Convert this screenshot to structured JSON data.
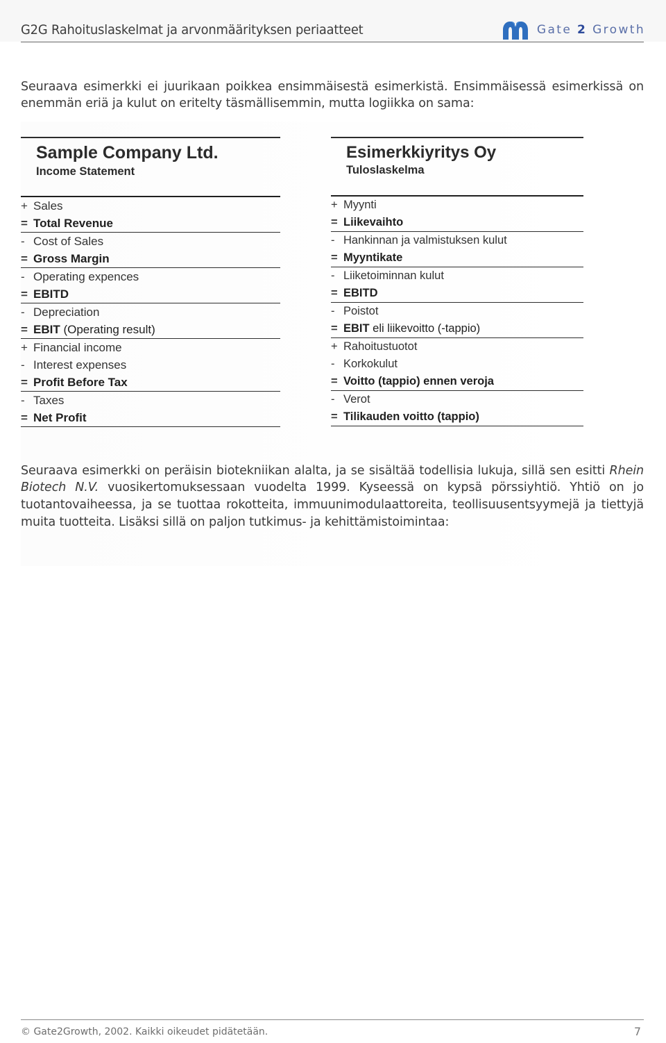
{
  "header": {
    "title": "G2G Rahoituslaskelmat ja arvonmäärityksen periaatteet",
    "brand_part1": "Gate",
    "brand_part2": "2",
    "brand_part3": "Growth",
    "logo_icon": "gate2growth-arch-logo",
    "brand_color": "#3b5ca8",
    "brand_text_color": "#5a6fa8"
  },
  "intro_paragraph": "Seuraava esimerkki ei juurikaan poikkea ensimmäisestä esimerkistä. Ensimmäisessä esimerkissä on enemmän eriä ja kulut on eritelty täsmällisemmin, mutta logiikka on sama:",
  "statements": [
    {
      "id": "sample-company-ltd",
      "title": "Sample Company Ltd.",
      "subtitle": "Income Statement",
      "rows": [
        {
          "op": "+",
          "label": "Sales",
          "total": false,
          "rule_after": false
        },
        {
          "op": "=",
          "label": "Total Revenue",
          "total": true,
          "rule_after": true
        },
        {
          "op": "-",
          "label": "Cost of Sales",
          "total": false,
          "rule_after": false
        },
        {
          "op": "=",
          "label": "Gross Margin",
          "total": true,
          "rule_after": true
        },
        {
          "op": "-",
          "label": "Operating expences",
          "total": false,
          "rule_after": false
        },
        {
          "op": "=",
          "label": "EBITD",
          "total": true,
          "rule_after": true
        },
        {
          "op": "-",
          "label": "Depreciation",
          "total": false,
          "rule_after": false
        },
        {
          "op": "=",
          "label": "EBIT",
          "label_suffix": " (Operating result)",
          "total": true,
          "rule_after": true
        },
        {
          "op": "+",
          "label": "Financial income",
          "total": false,
          "rule_after": false
        },
        {
          "op": "-",
          "label": "Interest expenses",
          "total": false,
          "rule_after": false
        },
        {
          "op": "=",
          "label": "Profit Before Tax",
          "total": true,
          "rule_after": true
        },
        {
          "op": "-",
          "label": "Taxes",
          "total": false,
          "rule_after": false
        },
        {
          "op": "=",
          "label": "Net Profit",
          "total": true,
          "rule_after": true
        }
      ]
    },
    {
      "id": "esimerkkiyritys-oy",
      "title": "Esimerkkiyritys Oy",
      "subtitle": "Tuloslaskelma",
      "rows": [
        {
          "op": "+",
          "label": "Myynti",
          "total": false,
          "rule_after": false
        },
        {
          "op": "=",
          "label": "Liikevaihto",
          "total": true,
          "rule_after": true
        },
        {
          "op": "-",
          "label": "Hankinnan ja valmistuksen kulut",
          "total": false,
          "rule_after": false
        },
        {
          "op": "=",
          "label": "Myyntikate",
          "total": true,
          "rule_after": true
        },
        {
          "op": "-",
          "label": "Liiketoiminnan kulut",
          "total": false,
          "rule_after": false
        },
        {
          "op": "=",
          "label": "EBITD",
          "total": true,
          "rule_after": true
        },
        {
          "op": "-",
          "label": "Poistot",
          "total": false,
          "rule_after": false
        },
        {
          "op": "=",
          "label": "EBIT",
          "label_suffix": " eli liikevoitto (-tappio)",
          "total": true,
          "rule_after": true
        },
        {
          "op": "+",
          "label": "Rahoitustuotot",
          "total": false,
          "rule_after": false
        },
        {
          "op": "-",
          "label": "Korkokulut",
          "total": false,
          "rule_after": false
        },
        {
          "op": "=",
          "label": "Voitto (tappio) ennen veroja",
          "total": true,
          "rule_after": true
        },
        {
          "op": "-",
          "label": "Verot",
          "total": false,
          "rule_after": false
        },
        {
          "op": "=",
          "label": "Tilikauden voitto (tappio)",
          "total": true,
          "rule_after": true
        }
      ]
    }
  ],
  "outro_paragraph": {
    "part1": "Seuraava esimerkki on peräisin biotekniikan alalta, ja se sisältää todellisia lukuja, sillä sen esitti ",
    "italic": "Rhein Biotech N.V.",
    "part2": " vuosikertomuksessaan vuodelta 1999. Kyseessä on kypsä pörssiyhtiö. Yhtiö on jo tuotantovaiheessa, ja se tuottaa rokotteita, immuunimodulaattoreita, teollisuusentsyymejä ja tiettyjä muita tuotteita. Lisäksi sillä on paljon tutkimus- ja kehittämistoimintaa:"
  },
  "footer": {
    "copyright": "© Gate2Growth, 2002.  Kaikki oikeudet pidätetään.",
    "page_number": "7"
  }
}
